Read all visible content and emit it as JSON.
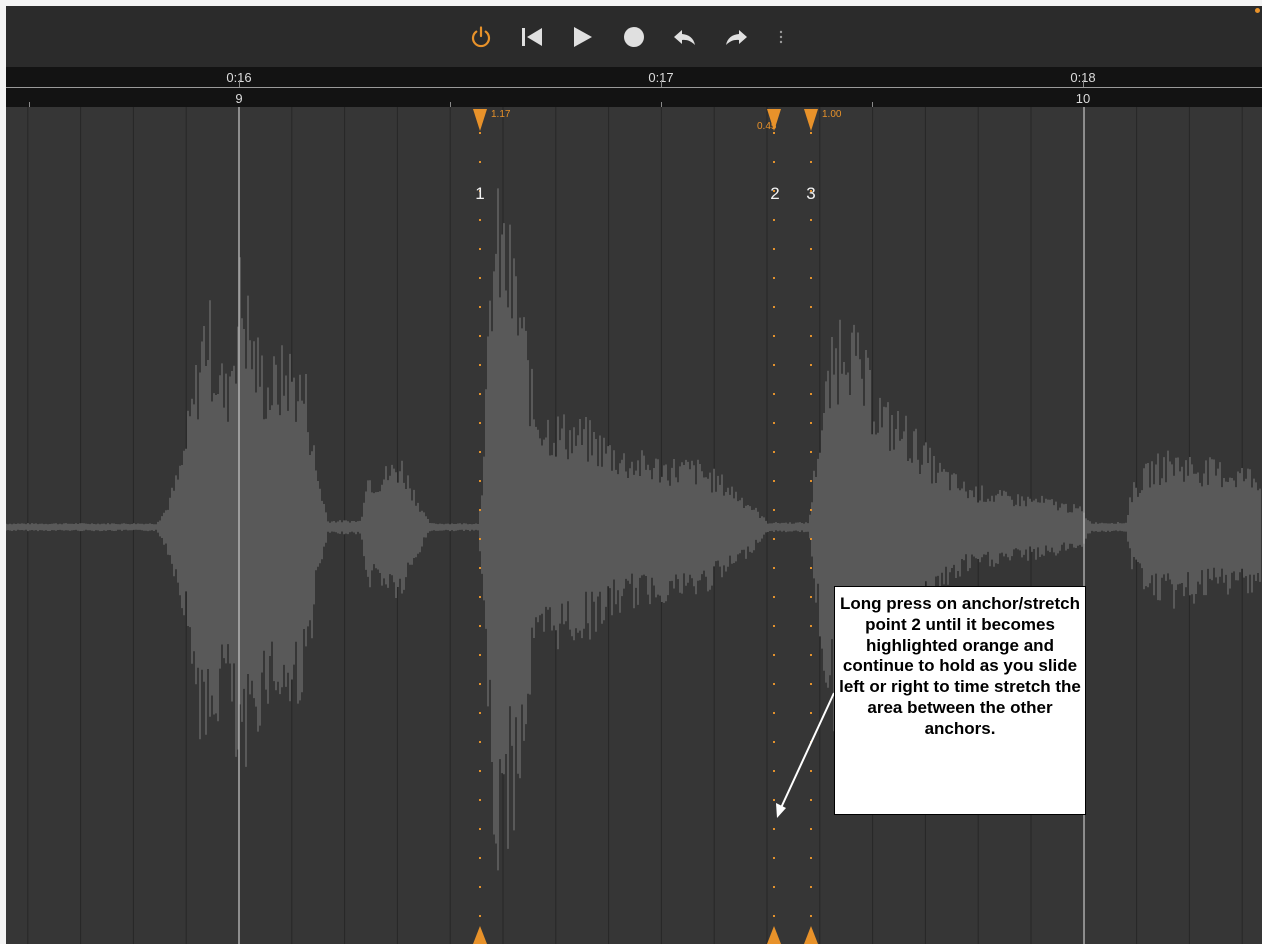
{
  "toolbar": {
    "buttons": [
      {
        "name": "power-button",
        "icon": "power-icon",
        "color": "#e8922a"
      },
      {
        "name": "skip-to-start-button",
        "icon": "skip-to-start-icon",
        "color": "#e0e0e0"
      },
      {
        "name": "play-button",
        "icon": "play-icon",
        "color": "#e0e0e0"
      },
      {
        "name": "record-button",
        "icon": "record-icon",
        "color": "#e0e0e0"
      },
      {
        "name": "undo-button",
        "icon": "undo-icon",
        "color": "#e0e0e0"
      },
      {
        "name": "redo-button",
        "icon": "redo-icon",
        "color": "#e0e0e0"
      },
      {
        "name": "more-button",
        "icon": "more-vertical-icon",
        "color": "#9a9a9a"
      }
    ],
    "status_dot_color": "#e8922a"
  },
  "ruler": {
    "times": [
      "0:16",
      "0:17",
      "0:18"
    ],
    "bars": [
      "9",
      "10"
    ]
  },
  "anchors": [
    {
      "number": "1",
      "ratio": "1.17"
    },
    {
      "number": "2",
      "ratio": "0.45"
    },
    {
      "number": "3",
      "ratio": "1.00"
    }
  ],
  "callout": {
    "text": "Long press on anchor/stretch point 2 until it becomes highlighted orange and continue to hold as you slide left or right to time stretch the area between the other anchors."
  },
  "colors": {
    "accent": "#e8922a",
    "waveform": "#595959",
    "background": "#363636"
  }
}
